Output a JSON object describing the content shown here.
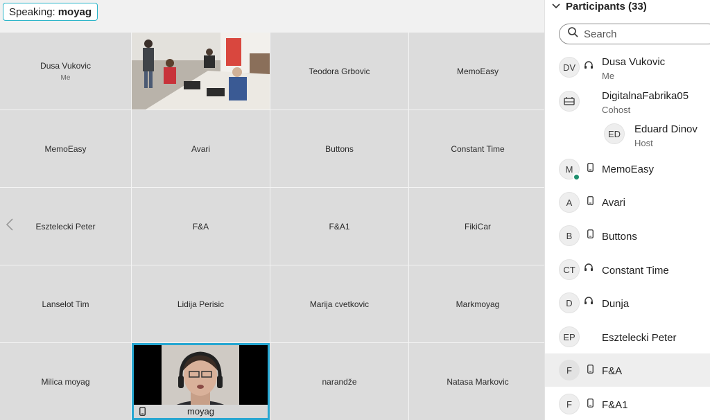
{
  "speaking": {
    "label": "Speaking:",
    "name": "moyag"
  },
  "grid": [
    {
      "name": "Dusa Vukovic",
      "sub": "Me"
    },
    {
      "name": "",
      "video": true
    },
    {
      "name": "Teodora Grbovic"
    },
    {
      "name": "MemoEasy"
    },
    {
      "name": "MemoEasy"
    },
    {
      "name": "Avari"
    },
    {
      "name": "Buttons"
    },
    {
      "name": "Constant Time"
    },
    {
      "name": "Esztelecki Peter"
    },
    {
      "name": "F&A"
    },
    {
      "name": "F&A1"
    },
    {
      "name": "FikiCar"
    },
    {
      "name": "Lanselot Tim"
    },
    {
      "name": "Lidija Perisic"
    },
    {
      "name": "Marija cvetkovic"
    },
    {
      "name": "Markmoyag"
    },
    {
      "name": "Milica moyag"
    },
    {
      "name": "moyag",
      "active": true
    },
    {
      "name": "narandže"
    },
    {
      "name": "Natasa Markovic"
    }
  ],
  "panel": {
    "title": "Participants (33)",
    "search_placeholder": "Search",
    "participants": [
      {
        "initials": "DV",
        "name": "Dusa Vukovic",
        "role": "Me",
        "device": "headset-icon"
      },
      {
        "initials": "",
        "name": "DigitalnaFabrika05",
        "role": "Cohost",
        "device": "room-device-icon"
      },
      {
        "initials": "ED",
        "name": "Eduard Dinov",
        "role": "Host",
        "device": ""
      },
      {
        "initials": "M",
        "name": "MemoEasy",
        "role": "",
        "device": "phone-icon"
      },
      {
        "initials": "A",
        "name": "Avari",
        "role": "",
        "device": "phone-icon"
      },
      {
        "initials": "B",
        "name": "Buttons",
        "role": "",
        "device": "phone-icon"
      },
      {
        "initials": "CT",
        "name": "Constant Time",
        "role": "",
        "device": "headset-icon"
      },
      {
        "initials": "D",
        "name": "Dunja",
        "role": "",
        "device": "headset-icon"
      },
      {
        "initials": "EP",
        "name": "Esztelecki Peter",
        "role": "",
        "device": ""
      },
      {
        "initials": "F",
        "name": "F&A",
        "role": "",
        "device": "phone-icon"
      },
      {
        "initials": "F",
        "name": "F&A1",
        "role": "",
        "device": "phone-icon"
      }
    ]
  },
  "colors": {
    "accent": "#26a6d1",
    "status_green": "#1e8f6e"
  }
}
